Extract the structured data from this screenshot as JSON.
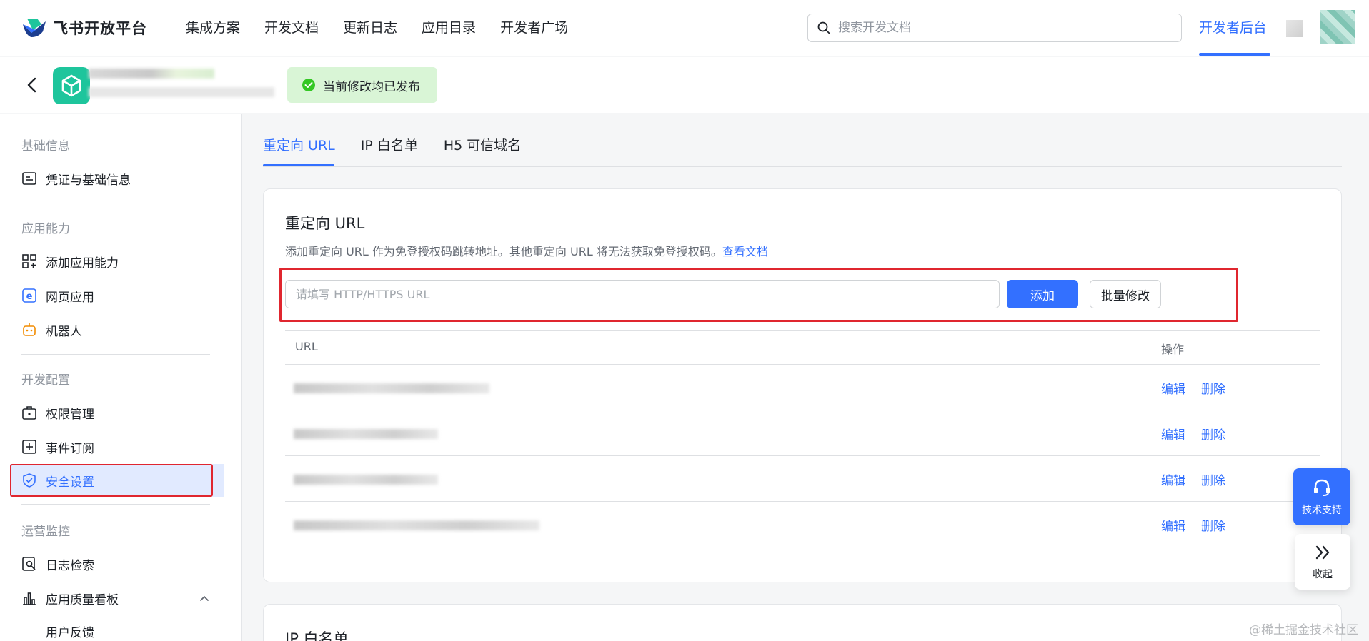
{
  "topnav": {
    "brand": "飞书开放平台",
    "links": [
      "集成方案",
      "开发文档",
      "更新日志",
      "应用目录",
      "开发者广场"
    ],
    "search_placeholder": "搜索开发文档",
    "dev_console": "开发者后台"
  },
  "appbar": {
    "publish_status": "当前修改均已发布"
  },
  "sidebar": {
    "groups": {
      "basic": "基础信息",
      "capability": "应用能力",
      "dev_config": "开发配置",
      "ops": "运营监控"
    },
    "items": {
      "credentials": "凭证与基础信息",
      "add_capability": "添加应用能力",
      "web_app": "网页应用",
      "bot": "机器人",
      "permissions": "权限管理",
      "events": "事件订阅",
      "security": "安全设置",
      "logs": "日志检索",
      "quality": "应用质量看板",
      "feedback": "用户反馈"
    }
  },
  "tabs": [
    "重定向 URL",
    "IP 白名单",
    "H5 可信域名"
  ],
  "redirect_card": {
    "title": "重定向 URL",
    "description": "添加重定向 URL 作为免登授权码跳转地址。其他重定向 URL 将无法获取免登授权码。",
    "doc_link": "查看文档",
    "input_placeholder": "请填写 HTTP/HTTPS URL",
    "add_button": "添加",
    "batch_button": "批量修改",
    "columns": {
      "url": "URL",
      "actions": "操作"
    },
    "row_actions": {
      "edit": "编辑",
      "delete": "删除"
    }
  },
  "ip_card": {
    "title": "IP 白名单"
  },
  "floating": {
    "support": "技术支持",
    "collapse": "收起"
  },
  "watermark": "@稀土掘金技术社区",
  "colors": {
    "accent": "#3370ff",
    "highlight": "#e0262f",
    "success_bg": "#d9f5d6"
  }
}
